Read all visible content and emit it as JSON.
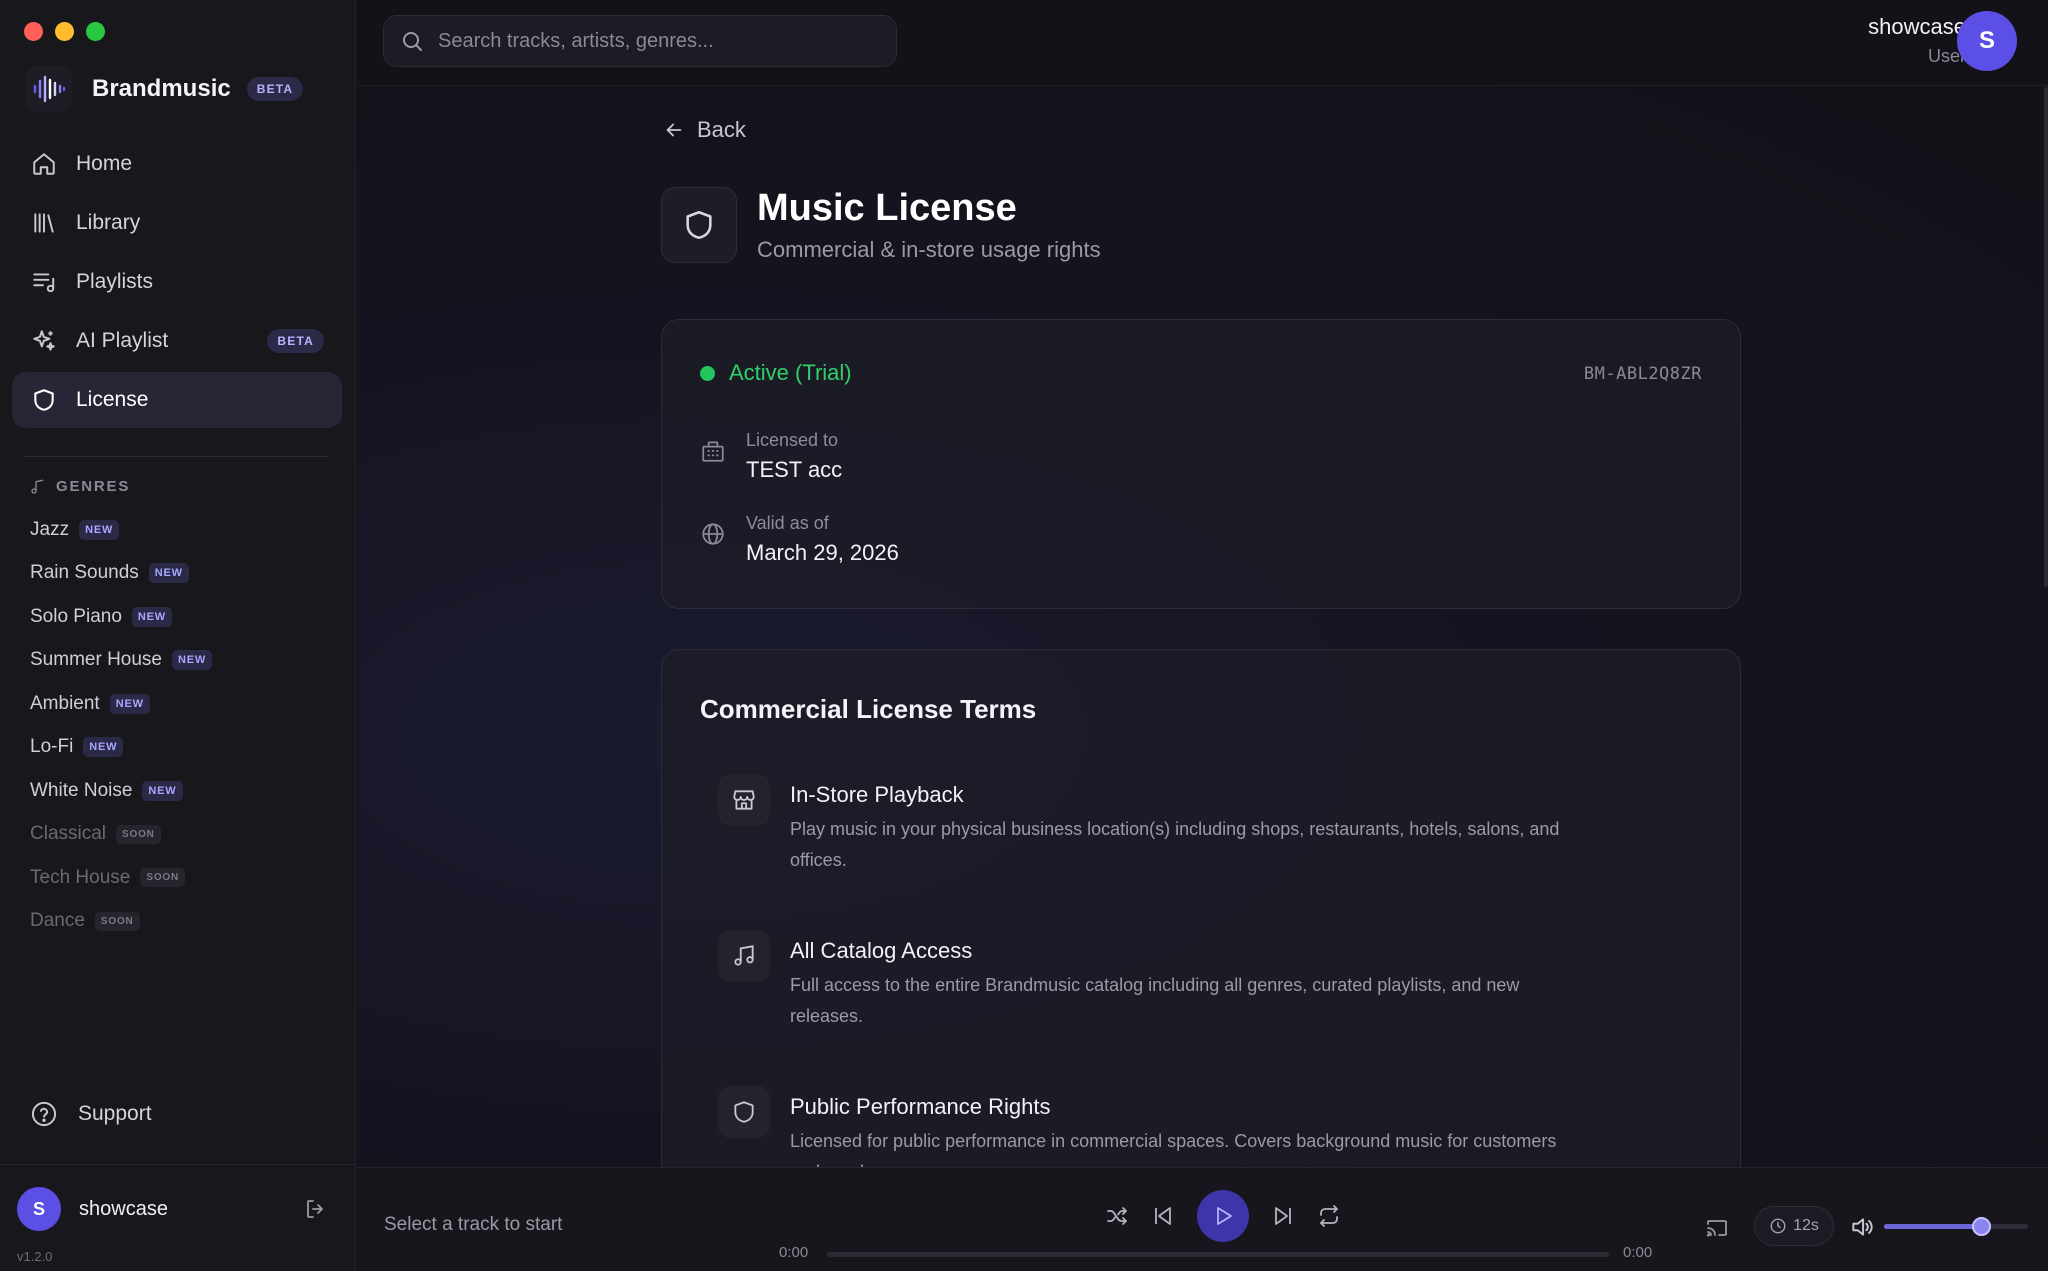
{
  "app": {
    "name": "Brandmusic",
    "badge": "BETA",
    "version": "v1.2.0"
  },
  "search": {
    "placeholder": "Search tracks, artists, genres..."
  },
  "top_user": {
    "name": "showcase",
    "role": "User",
    "initial": "S"
  },
  "nav": [
    {
      "label": "Home",
      "icon": "home-icon",
      "active": false
    },
    {
      "label": "Library",
      "icon": "library-icon",
      "active": false
    },
    {
      "label": "Playlists",
      "icon": "playlist-icon",
      "active": false
    },
    {
      "label": "AI Playlist",
      "icon": "sparkles-icon",
      "active": false,
      "badge": "BETA"
    },
    {
      "label": "License",
      "icon": "shield-icon",
      "active": true
    }
  ],
  "genres_heading": "GENRES",
  "genres": [
    {
      "label": "Jazz",
      "tag": "NEW",
      "available": true
    },
    {
      "label": "Rain Sounds",
      "tag": "NEW",
      "available": true
    },
    {
      "label": "Solo Piano",
      "tag": "NEW",
      "available": true
    },
    {
      "label": "Summer House",
      "tag": "NEW",
      "available": true
    },
    {
      "label": "Ambient",
      "tag": "NEW",
      "available": true
    },
    {
      "label": "Lo-Fi",
      "tag": "NEW",
      "available": true
    },
    {
      "label": "White Noise",
      "tag": "NEW",
      "available": true
    },
    {
      "label": "Classical",
      "tag": "SOON",
      "available": false
    },
    {
      "label": "Tech House",
      "tag": "SOON",
      "available": false
    },
    {
      "label": "Dance",
      "tag": "SOON",
      "available": false
    }
  ],
  "support_label": "Support",
  "side_user": {
    "name": "showcase",
    "initial": "S"
  },
  "page": {
    "back_label": "Back",
    "title": "Music License",
    "subtitle": "Commercial & in-store usage rights"
  },
  "license": {
    "status": "Active (Trial)",
    "status_color": "#22c55e",
    "key": "BM-ABL2Q8ZR",
    "licensed_to_label": "Licensed to",
    "licensed_to": "TEST acc",
    "valid_label": "Valid as of",
    "valid_date": "March 29, 2026"
  },
  "terms": {
    "title": "Commercial License Terms",
    "items": [
      {
        "icon": "store-icon",
        "title": "In-Store Playback",
        "desc_lines": [
          "Play music in your physical business location(s) including shops, restaurants, hotels, salons, and",
          "offices."
        ]
      },
      {
        "icon": "music-note-icon",
        "title": "All Catalog Access",
        "desc_lines": [
          "Full access to the entire Brandmusic catalog including all genres, curated playlists, and new",
          "releases."
        ]
      },
      {
        "icon": "shield-icon",
        "title": "Public Performance Rights",
        "desc_lines": [
          "Licensed for public performance in commercial spaces. Covers background music for customers",
          "and employees."
        ]
      }
    ]
  },
  "player": {
    "hint": "Select a track to start",
    "time_elapsed": "0:00",
    "time_total": "0:00",
    "progress": 0,
    "sleep_label": "12s",
    "volume": 0.68,
    "accent": "#3e35a8"
  }
}
